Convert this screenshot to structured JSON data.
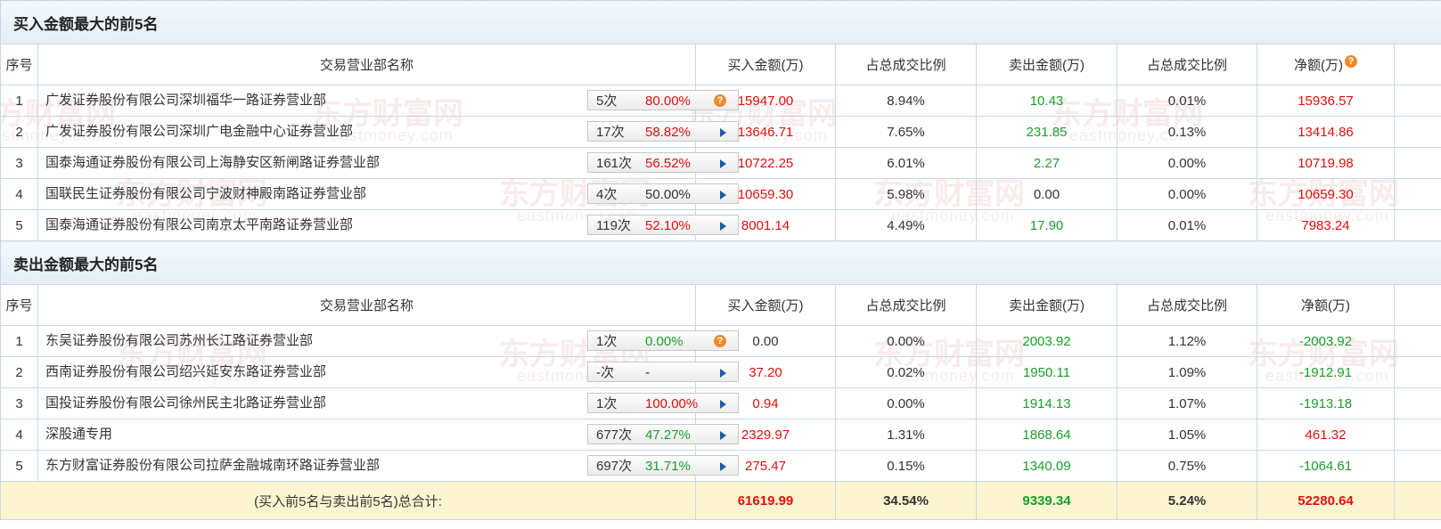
{
  "colors": {
    "up": "#e4100c",
    "down": "#1a9e2a",
    "header_bg": "#e3eef8",
    "total_bg": "#fdf5d2",
    "border": "#c9d7e6",
    "watermark": "#b33333"
  },
  "watermark": {
    "cn": "东方财富网",
    "en": "eastmoney.com"
  },
  "buy": {
    "title": "买入金额最大的前5名",
    "headers": [
      "序号",
      "交易营业部名称",
      "买入金额(万)",
      "占总成交比例",
      "卖出金额(万)",
      "占总成交比例",
      "净额(万)"
    ],
    "help_icon": "question-circle-icon",
    "rows": [
      {
        "no": "1",
        "name": "广发证券股份有限公司深圳福华一路证券营业部",
        "count": "5次",
        "rate": "80.00%",
        "rate_color": "up",
        "buy": "15947.00",
        "buy_pct": "8.94%",
        "sell": "10.43",
        "sell_pct": "0.01%",
        "net": "15936.57",
        "net_color": "up",
        "action": "question"
      },
      {
        "no": "2",
        "name": "广发证券股份有限公司深圳广电金融中心证券营业部",
        "count": "17次",
        "rate": "58.82%",
        "rate_color": "up",
        "buy": "13646.71",
        "buy_pct": "7.65%",
        "sell": "231.85",
        "sell_pct": "0.13%",
        "net": "13414.86",
        "net_color": "up",
        "action": "arrow"
      },
      {
        "no": "3",
        "name": "国泰海通证券股份有限公司上海静安区新闸路证券营业部",
        "count": "161次",
        "rate": "56.52%",
        "rate_color": "up",
        "buy": "10722.25",
        "buy_pct": "6.01%",
        "sell": "2.27",
        "sell_pct": "0.00%",
        "net": "10719.98",
        "net_color": "up",
        "action": "arrow"
      },
      {
        "no": "4",
        "name": "国联民生证券股份有限公司宁波财神殿南路证券营业部",
        "count": "4次",
        "rate": "50.00%",
        "rate_color": "neutral",
        "buy": "10659.30",
        "buy_pct": "5.98%",
        "sell": "0.00",
        "sell_pct": "0.00%",
        "net": "10659.30",
        "net_color": "up",
        "action": "arrow"
      },
      {
        "no": "5",
        "name": "国泰海通证券股份有限公司南京太平南路证券营业部",
        "count": "119次",
        "rate": "52.10%",
        "rate_color": "up",
        "buy": "8001.14",
        "buy_pct": "4.49%",
        "sell": "17.90",
        "sell_pct": "0.01%",
        "net": "7983.24",
        "net_color": "up",
        "action": "arrow"
      }
    ]
  },
  "sell": {
    "title": "卖出金额最大的前5名",
    "headers": [
      "序号",
      "交易营业部名称",
      "买入金额(万)",
      "占总成交比例",
      "卖出金额(万)",
      "占总成交比例",
      "净额(万)"
    ],
    "rows": [
      {
        "no": "1",
        "name": "东吴证券股份有限公司苏州长江路证券营业部",
        "count": "1次",
        "rate": "0.00%",
        "rate_color": "down",
        "buy": "0.00",
        "buy_pct": "0.00%",
        "sell": "2003.92",
        "sell_pct": "1.12%",
        "net": "-2003.92",
        "net_color": "down",
        "action": "question"
      },
      {
        "no": "2",
        "name": "西南证券股份有限公司绍兴延安东路证券营业部",
        "count": "-次",
        "rate": "-",
        "rate_color": "neutral",
        "buy": "37.20",
        "buy_pct": "0.02%",
        "sell": "1950.11",
        "sell_pct": "1.09%",
        "net": "-1912.91",
        "net_color": "down",
        "action": "arrow"
      },
      {
        "no": "3",
        "name": "国投证券股份有限公司徐州民主北路证券营业部",
        "count": "1次",
        "rate": "100.00%",
        "rate_color": "up",
        "buy": "0.94",
        "buy_pct": "0.00%",
        "sell": "1914.13",
        "sell_pct": "1.07%",
        "net": "-1913.18",
        "net_color": "down",
        "action": "arrow"
      },
      {
        "no": "4",
        "name": "深股通专用",
        "count": "677次",
        "rate": "47.27%",
        "rate_color": "down",
        "buy": "2329.97",
        "buy_pct": "1.31%",
        "sell": "1868.64",
        "sell_pct": "1.05%",
        "net": "461.32",
        "net_color": "up",
        "action": "arrow"
      },
      {
        "no": "5",
        "name": "东方财富证券股份有限公司拉萨金融城南环路证券营业部",
        "count": "697次",
        "rate": "31.71%",
        "rate_color": "down",
        "buy": "275.47",
        "buy_pct": "0.15%",
        "sell": "1340.09",
        "sell_pct": "0.75%",
        "net": "-1064.61",
        "net_color": "down",
        "action": "arrow"
      }
    ]
  },
  "total": {
    "label": "(买入前5名与卖出前5名)总合计:",
    "buy": "61619.99",
    "buy_pct": "34.54%",
    "sell": "9339.34",
    "sell_pct": "5.24%",
    "net": "52280.64"
  }
}
